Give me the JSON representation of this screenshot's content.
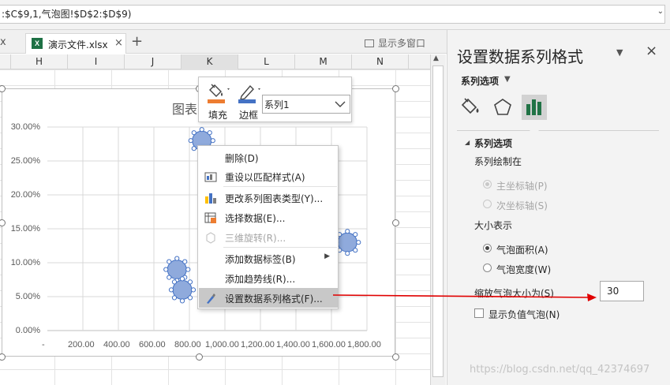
{
  "formula_bar": {
    "text": ":$C$9,1,气泡图!$D$2:$D$9)"
  },
  "tabs": {
    "prev_close": "x",
    "file_name": "演示文件.xlsx",
    "close": "×",
    "add": "+",
    "multi_window": "显示多窗口"
  },
  "columns": [
    "H",
    "I",
    "J",
    "K",
    "L",
    "M",
    "N"
  ],
  "chart": {
    "title": "图表",
    "yticks": [
      "30.00%",
      "25.00%",
      "20.00%",
      "15.00%",
      "10.00%",
      "5.00%",
      "0.00%"
    ],
    "xticks": [
      "-",
      "200.00",
      "400.00",
      "600.00",
      "800.00",
      "1,000.00",
      "1,200.00",
      "1,400.00",
      "1,600.00",
      "1,800.00"
    ]
  },
  "chart_data": {
    "type": "scatter",
    "title": "图表",
    "ylim": [
      0,
      0.3
    ],
    "xlim": [
      0,
      1800
    ],
    "yaxis_format": "percent",
    "series": [
      {
        "name": "系列1",
        "points": [
          {
            "x": 730,
            "y": 0.09
          },
          {
            "x": 760,
            "y": 0.06
          },
          {
            "x": 870,
            "y": 0.28
          },
          {
            "x": 1690,
            "y": 0.13
          }
        ]
      }
    ]
  },
  "mini_toolbar": {
    "fill": "填充",
    "border": "边框",
    "series_select": "系列1"
  },
  "context_menu": [
    {
      "label": "删除(D)",
      "icon": "",
      "disabled": false
    },
    {
      "label": "重设以匹配样式(A)",
      "icon": "reset-style-icon",
      "disabled": false
    },
    {
      "label": "更改系列图表类型(Y)...",
      "icon": "chart-type-icon",
      "disabled": false
    },
    {
      "label": "选择数据(E)...",
      "icon": "select-data-icon",
      "disabled": false
    },
    {
      "label": "三维旋转(R)...",
      "icon": "3d-rotate-icon",
      "disabled": true
    },
    {
      "label": "添加数据标签(B)",
      "icon": "",
      "disabled": false,
      "submenu": true
    },
    {
      "label": "添加趋势线(R)...",
      "icon": "",
      "disabled": false
    },
    {
      "label": "设置数据系列格式(F)...",
      "icon": "format-series-icon",
      "disabled": false,
      "highlighted": true
    }
  ],
  "pane": {
    "title": "设置数据系列格式",
    "close": "×",
    "options": "系列选项",
    "section": "系列选项",
    "plot_on": "系列绘制在",
    "primary_axis": "主坐标轴(P)",
    "secondary_axis": "次坐标轴(S)",
    "size_represents": "大小表示",
    "bubble_area": "气泡面积(A)",
    "bubble_width": "气泡宽度(W)",
    "scale_label": "缩放气泡大小为(S)",
    "scale_value": "30",
    "show_negative": "显示负值气泡(N)"
  },
  "watermark": "https://blog.csdn.net/qq_42374697",
  "colors": {
    "bubble_fill": "#8faadc",
    "bubble_edge": "#4472c4",
    "arrow": "#e00000",
    "fill_accent": "#ed7d31",
    "border_accent": "#4472c4"
  }
}
